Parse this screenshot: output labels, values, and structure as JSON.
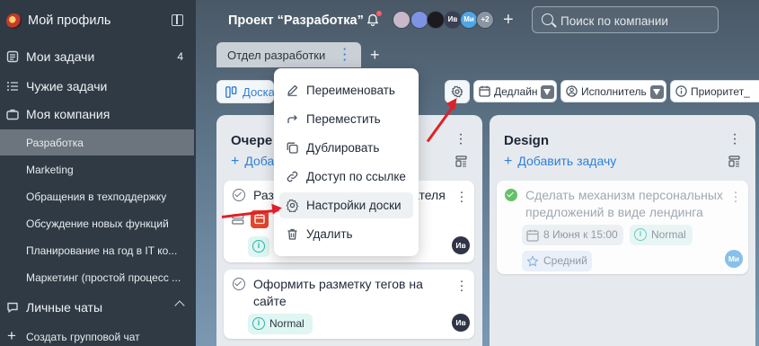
{
  "sidebar": {
    "profile_name": "Мой профиль",
    "items": [
      {
        "label": "Мои задачи",
        "count": "4"
      },
      {
        "label": "Чужие задачи"
      },
      {
        "label": "Моя компания"
      }
    ],
    "company_projects": [
      "Разработка",
      "Marketing",
      "Обращения в техподдержку",
      "Обсуждение новых функций",
      "Планирование на год в IT ко...",
      "Маркетинг (простой процесс ..."
    ],
    "personal_chats": "Личные чаты",
    "create_group_chat": "Создать групповой чат"
  },
  "header": {
    "project_title": "Проект “Разработка”",
    "members": [
      "Ив",
      "Ми"
    ],
    "more_members": "+2",
    "search_placeholder": "Поиск по компании"
  },
  "board_tab": {
    "label": "Отдел разработки"
  },
  "toolbar": {
    "view_label": "Доска",
    "chips": [
      "Дедлайн",
      "Исполнитель",
      "Приоритет_"
    ]
  },
  "menu": {
    "items": [
      {
        "label": "Переименовать",
        "icon": "pencil-icon"
      },
      {
        "label": "Переместить",
        "icon": "move-arrow-icon"
      },
      {
        "label": "Дублировать",
        "icon": "copy-icon"
      },
      {
        "label": "Доступ по ссылке",
        "icon": "link-icon"
      },
      {
        "label": "Настройки доски",
        "icon": "gear-icon"
      },
      {
        "label": "Удалить",
        "icon": "trash-icon"
      }
    ]
  },
  "columns": [
    {
      "title": "Очере",
      "add_task": "Доба",
      "cards": [
        {
          "title": "Разр",
          "title_tail": "ателя",
          "badge": "N",
          "assignee": "Ив"
        },
        {
          "title": "Оформить разметку тегов на сайте",
          "badge": "Normal",
          "assignee": "Ив"
        }
      ]
    },
    {
      "title": "Design",
      "add_task": "Добавить задачу",
      "cards": [
        {
          "title": "Сделать механизм персональных предложений в виде лендинга",
          "deadline": "8 Июня к 15:00",
          "badge": "Normal",
          "priority": "Средний",
          "assignee": "Ми"
        }
      ]
    }
  ],
  "colors": {
    "accent": "#2f7fd9",
    "sidebar_bg": "#2f3a44",
    "annotation_arrow": "#e0202a",
    "normal_badge_bg": "#dff6f3",
    "done_check": "#5bbd5c"
  }
}
